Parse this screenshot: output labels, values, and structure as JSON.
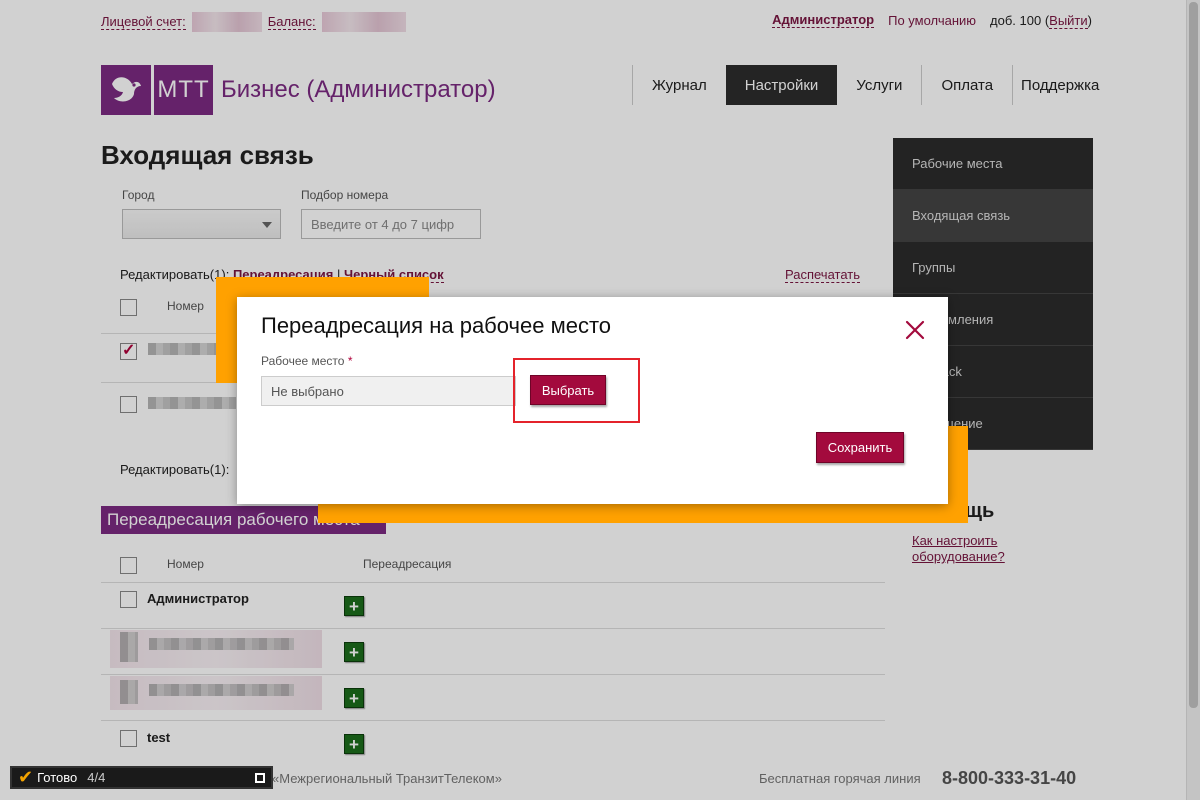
{
  "topbar": {
    "account_label": "Лицевой счет:",
    "balance_label": "Баланс:",
    "user": "Администратор",
    "profile": "По умолчанию",
    "ext_prefix": "доб. 100 (",
    "logout": "Выйти",
    "ext_suffix": ")"
  },
  "logo": {
    "mark": "МТТ",
    "title": "Бизнес (Администратор)"
  },
  "mainnav": [
    "Журнал",
    "Настройки",
    "Услуги",
    "Оплата",
    "Поддержка"
  ],
  "page_title": "Входящая связь",
  "filters": {
    "city_label": "Город",
    "number_label": "Подбор номера",
    "number_placeholder": "Введите от 4 до 7 цифр"
  },
  "edit": {
    "prefix": "Редактировать(1):",
    "redirect": "Переадресация",
    "separator": "|",
    "blacklist": "Черный список",
    "print": "Распечатать",
    "bottom_prefix": "Редактировать(1):"
  },
  "table1": {
    "col_number": "Номер"
  },
  "sidebar": {
    "items": [
      "Рабочие места",
      "Входящая связь",
      "Группы",
      "Уведомления",
      "Callback",
      "Сообщение"
    ],
    "help_title": "Помощь",
    "help_link": "Как настроить оборудование?"
  },
  "section2": {
    "title": "Переадресация рабочего места",
    "col_number": "Номер",
    "col_redirect": "Переадресация",
    "rows": [
      "Администратор",
      "",
      "",
      "test"
    ]
  },
  "footer": {
    "copyright": "«Межрегиональный ТранзитТелеком»",
    "hotline_label": "Бесплатная горячая линия",
    "phone": "8-800-333-31-40"
  },
  "modal": {
    "title": "Переадресация на рабочее место",
    "field_label": "Рабочее место",
    "required_mark": "*",
    "field_value": "Не выбрано",
    "choose_button": "Выбрать",
    "save_button": "Сохранить"
  },
  "taskbar": {
    "status": "Готово",
    "progress": "4/4"
  },
  "colors": {
    "brand": "#7c2a82",
    "accent": "#a30a3d",
    "highlight": "#ffa100",
    "frame": "#e4232b"
  }
}
